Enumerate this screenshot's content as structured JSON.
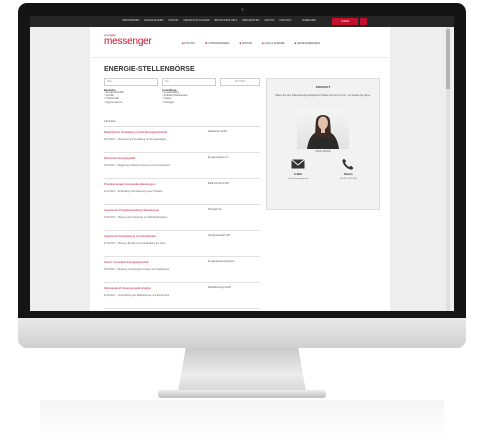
{
  "topbar": {
    "nav": [
      "ABONNIEREN",
      "ENERGIEJOBS",
      "FORUM",
      "VERANSTALTUNGEN",
      "BRANCHENLINKS",
      "MEDIADATEN",
      "ARCHIV",
      "KONTAKT"
    ],
    "login": "ANMELDEN",
    "cta": "LOGIN"
  },
  "header": {
    "logo_small": "energate",
    "logo": "messenger",
    "nav": [
      "POLITIK",
      "UNTERNEHMEN",
      "STROM",
      "GAS & WÄRME",
      "NEUE ENERGIEN"
    ]
  },
  "main": {
    "title": "ENERGIE-STELLENBÖRSE",
    "search_placeholder": "Was",
    "location_placeholder": "Wo",
    "search_button": "SUCHEN",
    "group1_title": "Bereiche",
    "group1_items": [
      "Energiewirtschaft",
      "Vertrieb",
      "IT/Informatik",
      "Ingenieurwesen"
    ],
    "group2_title": "Anstellung",
    "group2_items": [
      "Festanstellung",
      "Praktikum/Werkstudent",
      "Trainee",
      "Sonstiges"
    ],
    "count": "146 Stellen",
    "jobs": [
      {
        "title": "Mitarbeiter/in Verwaltung (m/w/d) Energiewirtschaft",
        "desc": "06.10.2017 – Steuerung und Verwaltung von Energieanlagen.",
        "company": "Stadtwerke GmbH"
      },
      {
        "title": "Referent/in Energiepolitik",
        "desc": "04.10.2017 – Begleitung politischer Prozesse und Gremienarbeit.",
        "company": "Energieverband e.V."
      },
      {
        "title": "Produktmanager Energiedienstleistungen",
        "desc": "02.10.2017 – Entwicklung und Steuerung neuer Produkte.",
        "company": "EWE Vertrieb GmbH"
      },
      {
        "title": "Ingenieur/in Projektentwicklung Windenergie",
        "desc": "29.09.2017 – Planung und Umsetzung von Windparkprojekten.",
        "company": "Windpark AG"
      },
      {
        "title": "Ingenieur/in Netzplanung und Netzbetrieb",
        "desc": "27.09.2017 – Planung, Betrieb und Instandhaltung der Netze.",
        "company": "Netzgesellschaft mbH"
      },
      {
        "title": "Senior Consultant Energiewirtschaft",
        "desc": "25.09.2017 – Beratung von Energieversorgern und Stadtwerken.",
        "company": "Energieberatung Partners"
      },
      {
        "title": "Werkstudent/in Energiemarkt-Analyse",
        "desc": "22.09.2017 – Unterstützung bei Marktanalysen und Recherchen.",
        "company": "Marktforschung GmbH"
      }
    ]
  },
  "sidebar": {
    "title": "KONTAKT",
    "text": "Haben Sie eine Stellenanzeige aufzugeben? Melden Sie sich bei uns – wir beraten Sie gerne.",
    "name": "Kristin Schmidt",
    "email_label": "E-Mail",
    "phone_label": "Telefon",
    "email_value": "service@energate.de",
    "phone_value": "+49 201 1022-500"
  },
  "colors": {
    "accent": "#c3112b",
    "topbar": "#262626",
    "page_bg": "#eeeeee"
  },
  "icons": [
    "mail-icon",
    "phone-icon",
    "portrait-photo"
  ]
}
